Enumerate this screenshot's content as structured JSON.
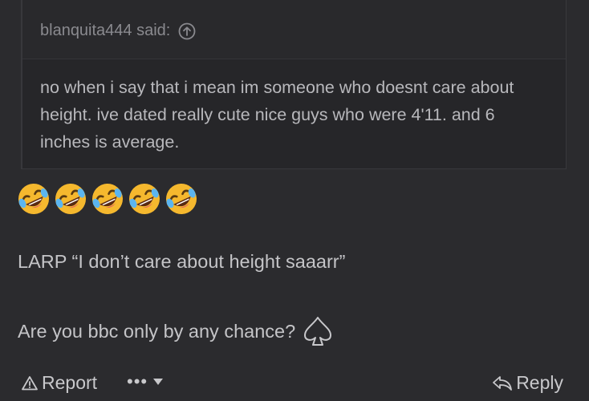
{
  "quote": {
    "author_line": "blanquita444 said:",
    "icon": "arrow-up-circle-icon",
    "text": "no when i say that i mean im someone who doesnt care about height. ive dated really cute nice guys who were 4'11. and 6 inches is average."
  },
  "post": {
    "emojis": [
      "🤣",
      "🤣",
      "🤣",
      "🤣",
      "🤣"
    ],
    "line1": "LARP “I don’t care about height saaarr”",
    "line2": "Are you bbc only by any chance?",
    "line2_icon": "spade-icon"
  },
  "actions": {
    "report_label": "Report",
    "report_icon": "warning-triangle-icon",
    "more_label": "•••",
    "more_icon": "caret-down-icon",
    "reply_label": "Reply",
    "reply_icon": "reply-arrow-icon"
  }
}
